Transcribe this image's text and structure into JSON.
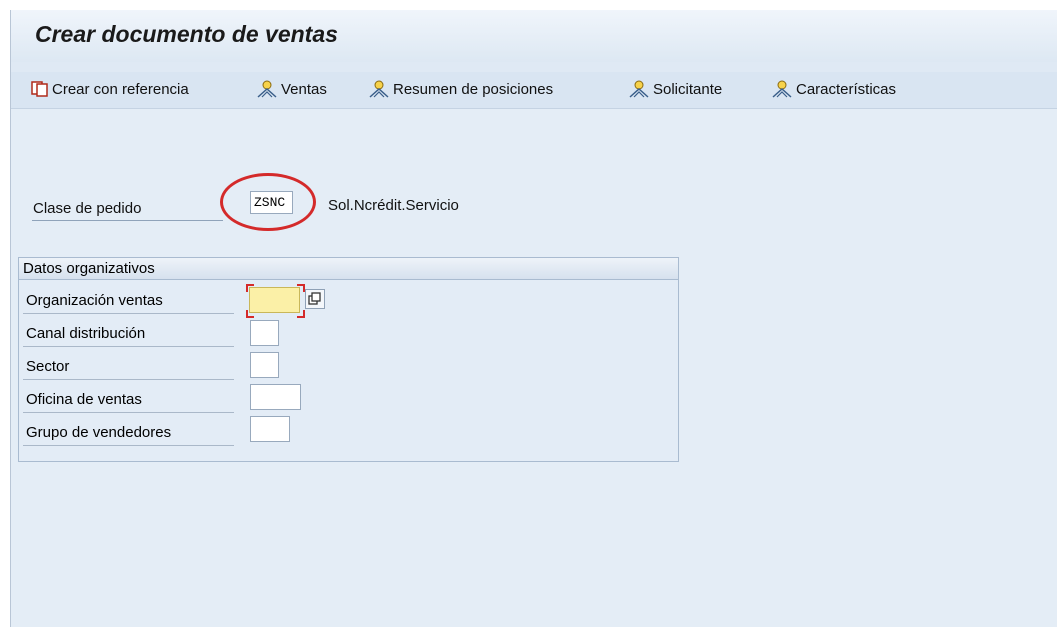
{
  "window": {
    "title": "Crear documento de ventas"
  },
  "toolbar": {
    "items": [
      {
        "label": "Crear con referencia",
        "icon": "create-with-reference-icon"
      },
      {
        "label": "Ventas",
        "icon": "person-icon"
      },
      {
        "label": "Resumen de posiciones",
        "icon": "person-icon"
      },
      {
        "label": "Solicitante",
        "icon": "person-icon"
      },
      {
        "label": "Características",
        "icon": "person-icon"
      }
    ]
  },
  "header": {
    "order_type_label": "Clase de pedido",
    "order_type_value": "ZSNC",
    "order_type_description": "Sol.Ncrédit.Servicio"
  },
  "org_data": {
    "title": "Datos organizativos",
    "fields": [
      {
        "label": "Organización ventas",
        "value": ""
      },
      {
        "label": "Canal distribución",
        "value": ""
      },
      {
        "label": "Sector",
        "value": ""
      },
      {
        "label": "Oficina de ventas",
        "value": ""
      },
      {
        "label": "Grupo de vendedores",
        "value": ""
      }
    ]
  },
  "colors": {
    "background": "#dfe9f4",
    "highlight": "#d42a2a",
    "required_field": "#fbf0a7"
  }
}
